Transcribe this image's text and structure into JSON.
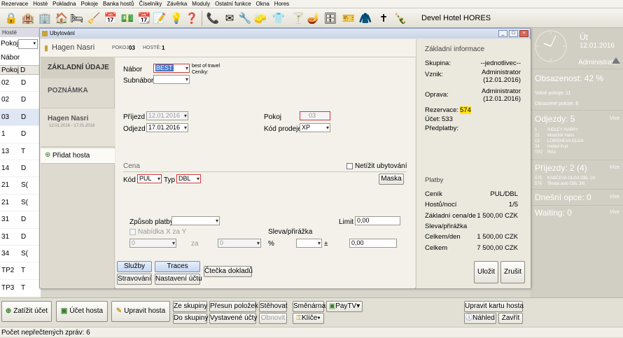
{
  "menubar": [
    "Rezervace",
    "Hosté",
    "Pokladna",
    "Pokoje",
    "Banka hostů",
    "Číselníky",
    "Závěrka",
    "Moduly",
    "Ostatní funkce",
    "Okna",
    "Hores"
  ],
  "toolbar": {
    "hotel_title": "Devel Hotel HORES"
  },
  "guests_window": {
    "title": "Hosté",
    "filter_label": "Pokoj",
    "nabor_label": "Nábor",
    "column_header": "Pokoj",
    "column_header_2": "D",
    "rows": [
      {
        "room": "02",
        "col": "D"
      },
      {
        "room": "02",
        "col": "D"
      },
      {
        "room": "03",
        "col": "D"
      },
      {
        "room": "1",
        "col": "D"
      },
      {
        "room": "13",
        "col": "T"
      },
      {
        "room": "14",
        "col": "D"
      },
      {
        "room": "21",
        "col": "S("
      },
      {
        "room": "21",
        "col": "S("
      },
      {
        "room": "31",
        "col": "D"
      },
      {
        "room": "31",
        "col": "D"
      },
      {
        "room": "34",
        "col": "S("
      },
      {
        "room": "TP2",
        "col": "T"
      },
      {
        "room": "TP3",
        "col": "T"
      }
    ]
  },
  "right_panel": {
    "day": "Út",
    "date": "12.01.2016",
    "user": "Administrator",
    "occupancy": "Obsazenost: 42 %",
    "free_rooms": "Volné pokoje: 11",
    "occupied_rooms": "Obsazené pokoje: 8",
    "departures": "Odjezdy: 5",
    "departures_vice": "Více",
    "departure_items": [
      {
        "room": "1",
        "name": "RIDLEY HARRY"
      },
      {
        "room": "21",
        "name": "Moučník Hans"
      },
      {
        "room": "13",
        "name": "LOBISHEVA OLGA"
      },
      {
        "room": "34",
        "name": "Heidel Kurt"
      },
      {
        "room": "TP2",
        "name": "Rišo"
      }
    ],
    "arrivals": "Příjezdy: 2 (4)",
    "arrivals_vice": "Více",
    "arrival_items": [
      {
        "room": "575",
        "name": "KABČEVA OLGA DBL 1/2"
      },
      {
        "room": "576",
        "name": "Škoda auto DBL 3/6"
      }
    ],
    "options": "Dnešní opce: 0",
    "options_vice": "Více",
    "waiting": "Waiting: 0",
    "waiting_vice": "Více"
  },
  "dialog": {
    "title": "Ubytování",
    "guest_name": "Hagen Nasri",
    "rooms_label": "POKOJ:",
    "rooms_value": "03",
    "guests_label": "HOSTÉ:",
    "guests_value": "1",
    "tabs": [
      "ZÁKLADNÍ ÚDAJE",
      "POZNÁMKA"
    ],
    "guest_entry_name": "Hagen Nasri",
    "guest_entry_dates": "12.01.2016 - 17.01.2016",
    "add_guest": "Přidat hosta",
    "form": {
      "nabor_label": "Nábor",
      "nabor_value": "BEST",
      "nabor_desc": "best of travel",
      "ceniky_label": "Ceníky:",
      "subnabor_label": "Subnábor",
      "prijezd_label": "Příjezd",
      "prijezd_value": "12.01.2016",
      "odjezd_label": "Odjezd",
      "odjezd_value": "17.01.2016",
      "pokoj_label": "Pokoj",
      "pokoj_value": "03",
      "kod_prodeje_label": "Kód prodeje",
      "kod_prodeje_value": "XP",
      "cena_label": "Cena",
      "netizit_label": "Netížit ubytování",
      "kod_label": "Kód",
      "kod_value": "PUL",
      "typ_label": "Typ",
      "typ_value": "DBL",
      "maska_button": "Maska",
      "zpusob_label": "Způsob platby",
      "limit_label": "Limit",
      "limit_value": "0,00",
      "nabidka_label": "Nabídka X za Y",
      "nabidka_x": "0",
      "za_label": "za",
      "nabidka_y": "0",
      "sleva_label": "Sleva/přirážka",
      "percent_label": "%",
      "plusminus_label": "±",
      "sleva_value": "0,00"
    },
    "buttons": {
      "sluzby": "Služby",
      "traces": "Traces",
      "ctecka": "Čtečka dokladů",
      "stravovani": "Stravování",
      "nastaveni": "Nastavení účtu",
      "ulozit": "Uložit",
      "zrusit": "Zrušit"
    },
    "info": {
      "header": "Základní informace",
      "skupina_label": "Skupina:",
      "skupina_value": "--jednotlivec--",
      "vznik_label": "Vznik:",
      "vznik_user": "Administrator",
      "vznik_date": "(12.01.2016)",
      "oprava_label": "Oprava:",
      "oprava_user": "Administrator",
      "oprava_date": "(12.01.2016)",
      "rezervace_label": "Rezervace:",
      "rezervace_value": "574",
      "ucet_label": "Účet:",
      "ucet_value": "533",
      "predplatby_label": "Předplatby:",
      "platby_header": "Platby",
      "cenik_label": "Ceník",
      "cenik_value": "PUL/DBL",
      "hostu_label": "Hostů/nocí",
      "hostu_value": "1/5",
      "zakladni_label": "Základní cena/de",
      "zakladni_value": "1 500,00 CZK",
      "sleva_label": "Sleva/přirážka",
      "celkem_den_label": "Celkem/den",
      "celkem_den_value": "1 500,00 CZK",
      "celkem_label": "Celkem",
      "celkem_value": "7 500,00 CZK"
    }
  },
  "actions": {
    "zatizit": "Zatížit účet",
    "ucet_hosta": "Účet hosta",
    "upravit_hosta": "Upravit hosta",
    "ze_skupiny": "Ze skupiny",
    "do_skupiny": "Do skupiny",
    "presun": "Přesun položek",
    "vystavene": "Vystavené účty",
    "stehovat": "Stěhovat",
    "obnovit": "Obnovit",
    "smenarna": "Směnárna",
    "klice": "Klíče",
    "paytv": "PayTV",
    "upravit_kartu": "Upravit kartu hosta",
    "nahled": "Náhled",
    "zavrit": "Zavřít"
  },
  "status": {
    "text": "Počet nepřečtených zpráv: 6"
  }
}
